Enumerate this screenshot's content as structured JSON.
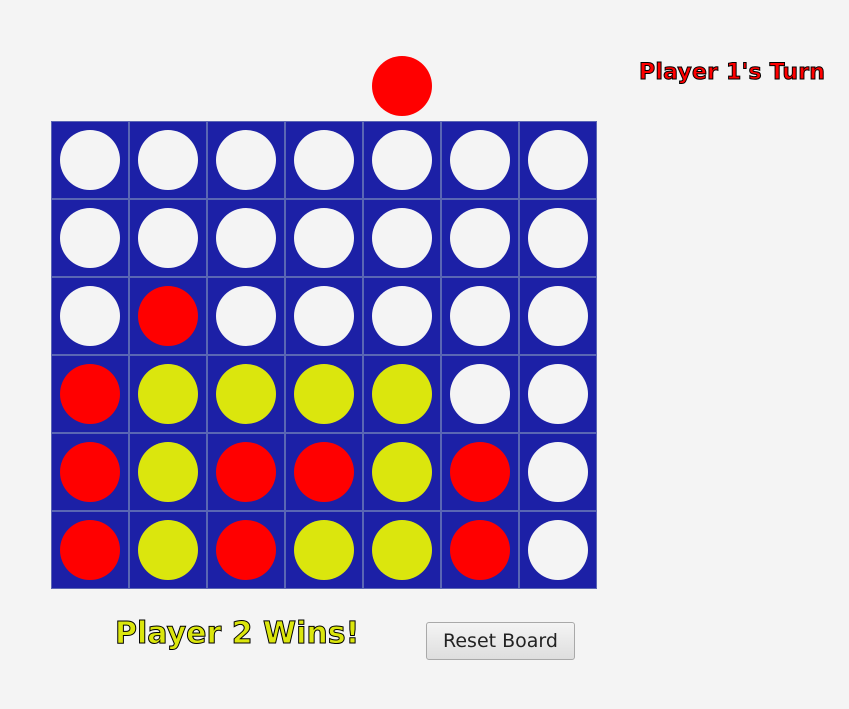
{
  "colors": {
    "board": "#1c20a6",
    "empty": "#f4f4f4",
    "red": "#ff0000",
    "yellow": "#dbe60d"
  },
  "hover_piece": {
    "player": "red"
  },
  "turn_label": {
    "text": "Player 1's Turn",
    "color": "red"
  },
  "board": {
    "rows": 6,
    "columns": 7,
    "cells": [
      [
        "empty",
        "empty",
        "empty",
        "empty",
        "empty",
        "empty",
        "empty"
      ],
      [
        "empty",
        "empty",
        "empty",
        "empty",
        "empty",
        "empty",
        "empty"
      ],
      [
        "empty",
        "red",
        "empty",
        "empty",
        "empty",
        "empty",
        "empty"
      ],
      [
        "red",
        "yellow",
        "yellow",
        "yellow",
        "yellow",
        "empty",
        "empty"
      ],
      [
        "red",
        "yellow",
        "red",
        "red",
        "yellow",
        "red",
        "empty"
      ],
      [
        "red",
        "yellow",
        "red",
        "yellow",
        "yellow",
        "red",
        "empty"
      ]
    ]
  },
  "status": {
    "text": "Player 2 Wins!",
    "color": "yellow"
  },
  "controls": {
    "reset_label": "Reset Board"
  }
}
